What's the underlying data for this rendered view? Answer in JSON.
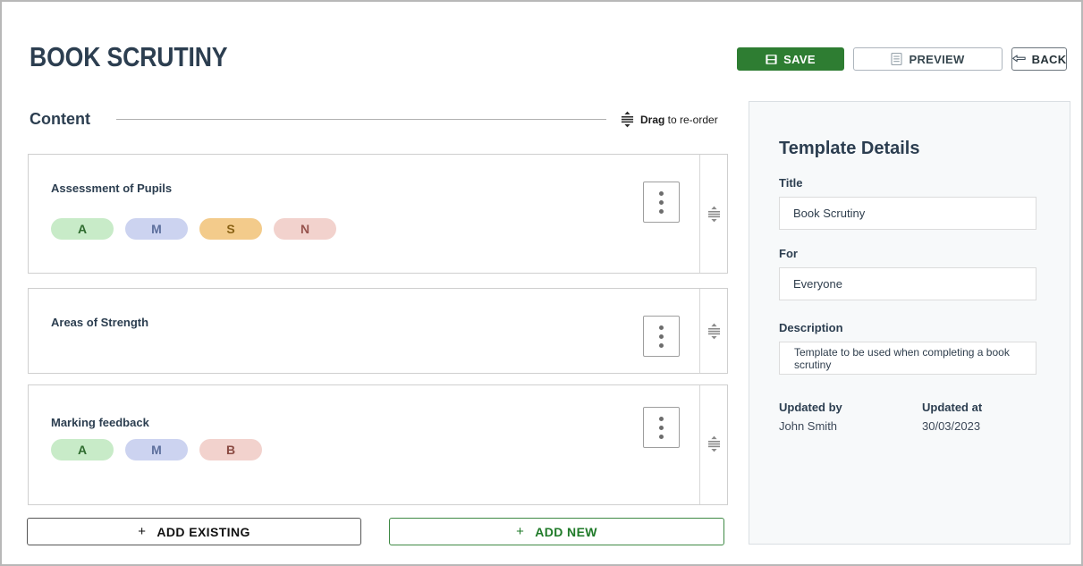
{
  "header": {
    "title": "BOOK SCRUTINY",
    "actions": [
      {
        "label": "SAVE",
        "icon": "save-icon"
      },
      {
        "label": "PREVIEW",
        "icon": "document-icon"
      },
      {
        "label": "BACK",
        "icon": "arrow-left-icon"
      }
    ]
  },
  "content": {
    "label": "Content",
    "drag_hint_strong": "Drag",
    "drag_hint_rest": " to re-order",
    "drag_icon": "drag-reorder-icon",
    "cards": [
      {
        "title": "Assessment of Pupils",
        "pills": [
          {
            "label": "A",
            "bg": "#c8ebc8",
            "fg": "#2e6b2e"
          },
          {
            "label": "M",
            "bg": "#ccd3f0",
            "fg": "#5d6f9c"
          },
          {
            "label": "S",
            "bg": "#f3cb8b",
            "fg": "#8a6214"
          },
          {
            "label": "N",
            "bg": "#f2d2cd",
            "fg": "#97534d"
          }
        ]
      },
      {
        "title": "Areas of Strength",
        "pills": []
      },
      {
        "title": "Marking feedback",
        "pills": [
          {
            "label": "A",
            "bg": "#c8ebc8",
            "fg": "#2e6b2e"
          },
          {
            "label": "M",
            "bg": "#ccd3f0",
            "fg": "#5d6f9c"
          },
          {
            "label": "B",
            "bg": "#f2d2cd",
            "fg": "#8a4a42"
          }
        ]
      }
    ],
    "add_existing_label": "ADD EXISTING",
    "add_new_label": "ADD NEW",
    "plus_glyph": "+"
  },
  "panel": {
    "title": "Template Details",
    "fields": [
      {
        "label": "Title",
        "value": "Book Scrutiny"
      },
      {
        "label": "For",
        "value": "Everyone"
      },
      {
        "label": "Description",
        "value": "Template to be used when completing a book scrutiny"
      }
    ],
    "meta": [
      {
        "label": "Updated by",
        "value": "John Smith"
      },
      {
        "label": "Updated at",
        "value": "30/03/2023"
      }
    ]
  },
  "colors": {
    "brand_green": "#2e7d32",
    "title_navy": "#2c3e50",
    "panel_bg": "#f7f9fa"
  }
}
